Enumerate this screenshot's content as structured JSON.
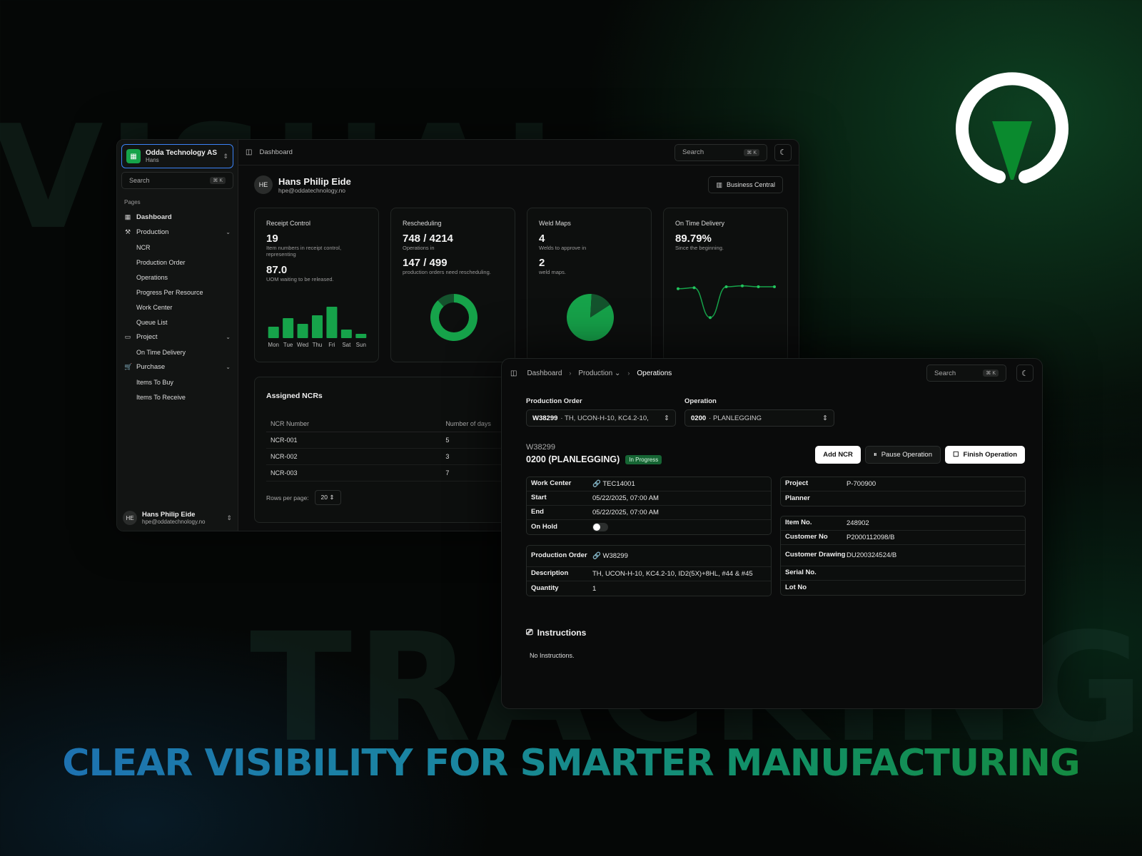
{
  "background": {
    "word_top": "VISUAL",
    "word_bottom": "TRACKING",
    "tagline": "CLEAR VISIBILITY FOR SMARTER MANUFACTURING"
  },
  "colors": {
    "accent": "#16a34a",
    "focus": "#3b82f6",
    "brand_green": "#0a8a2e"
  },
  "dashboard": {
    "org": {
      "name": "Odda Technology AS",
      "sub": "Hans"
    },
    "search": {
      "placeholder": "Search",
      "shortcut": "⌘ K"
    },
    "pages_label": "Pages",
    "nav": {
      "dashboard": "Dashboard",
      "production": "Production",
      "production_items": [
        "NCR",
        "Production Order",
        "Operations",
        "Progress Per Resource",
        "Work Center",
        "Queue List"
      ],
      "project": "Project",
      "project_items": [
        "On Time Delivery"
      ],
      "purchase": "Purchase",
      "purchase_items": [
        "Items To Buy",
        "Items To Receive"
      ]
    },
    "sidebar_user": {
      "initials": "HE",
      "name": "Hans Philip Eide",
      "email": "hpe@oddatechnology.no"
    },
    "breadcrumb": "Dashboard",
    "user": {
      "initials": "HE",
      "name": "Hans Philip Eide",
      "email": "hpe@oddatechnology.no"
    },
    "bc_button": "Business Central",
    "cards": {
      "receipt": {
        "title": "Receipt Control",
        "v1": "19",
        "d1": "Item numbers in receipt control, representing",
        "v2": "87.0",
        "d2": "UOM waiting to be released."
      },
      "resched": {
        "title": "Rescheduling",
        "v1": "748 / 4214",
        "d1": "Operations in",
        "v2": "147 / 499",
        "d2": "production orders need rescheduling."
      },
      "weld": {
        "title": "Weld Maps",
        "v1": "4",
        "d1": "Welds to approve in",
        "v2": "2",
        "d2": "weld maps."
      },
      "otd": {
        "title": "On Time Delivery",
        "v1": "89.79%",
        "d1": "Since the beginning."
      }
    },
    "ncr": {
      "title": "Assigned NCRs",
      "headers": [
        "NCR Number",
        "Number of days"
      ],
      "rows": [
        [
          "NCR-001",
          "5"
        ],
        [
          "NCR-002",
          "3"
        ],
        [
          "NCR-003",
          "7"
        ]
      ],
      "rows_per_page_label": "Rows per page:",
      "rows_per_page": "20"
    }
  },
  "chart_data": [
    {
      "type": "bar",
      "categories": [
        "Mon",
        "Tue",
        "Wed",
        "Thu",
        "Fri",
        "Sat",
        "Sun"
      ],
      "values": [
        4,
        7,
        5,
        8,
        11,
        3,
        1.5
      ]
    },
    {
      "type": "pie",
      "series": [
        {
          "values": [
            88,
            12
          ]
        }
      ]
    },
    {
      "type": "pie",
      "series": [
        {
          "values": [
            85,
            15
          ]
        }
      ]
    },
    {
      "type": "line",
      "x": [
        1,
        2,
        3,
        4,
        5,
        6,
        7
      ],
      "values": [
        90,
        91,
        60,
        92,
        93,
        92,
        92
      ]
    }
  ],
  "operation": {
    "breadcrumb": [
      "Dashboard",
      "Production",
      "Operations"
    ],
    "search": {
      "placeholder": "Search",
      "shortcut": "⌘ K"
    },
    "po_label": "Production Order",
    "po_value_bold": "W38299",
    "po_value": "· TH, UCON-H-10, KC4.2-10,",
    "op_label": "Operation",
    "op_value_bold": "0200",
    "op_value": "· PLANLEGGING",
    "order_no": "W38299",
    "op_title": "0200 (PLANLEGGING)",
    "status": "In Progress",
    "buttons": {
      "add_ncr": "Add NCR",
      "pause": "Pause Operation",
      "finish": "Finish Operation"
    },
    "wc": {
      "work_center_k": "Work Center",
      "work_center_v": "TEC14001",
      "start_k": "Start",
      "start_v": "05/22/2025, 07:00 AM",
      "end_k": "End",
      "end_v": "05/22/2025, 07:00 AM",
      "hold_k": "On Hold"
    },
    "po": {
      "po_k": "Production Order",
      "po_v": "W38299",
      "desc_k": "Description",
      "desc_v": "TH, UCON-H-10, KC4.2-10, ID2(5X)+8HL, #44 & #45",
      "qty_k": "Quantity",
      "qty_v": "1"
    },
    "proj": {
      "project_k": "Project",
      "project_v": "P-700900",
      "planner_k": "Planner"
    },
    "item": {
      "item_k": "Item No.",
      "item_v": "248902",
      "cust_k": "Customer No",
      "cust_v": "P2000112098/B",
      "draw_k": "Customer Drawing",
      "draw_v": "DU200324524/B",
      "serial_k": "Serial No.",
      "lot_k": "Lot No"
    },
    "instructions_title": "Instructions",
    "instructions_text": "No Instructions."
  }
}
